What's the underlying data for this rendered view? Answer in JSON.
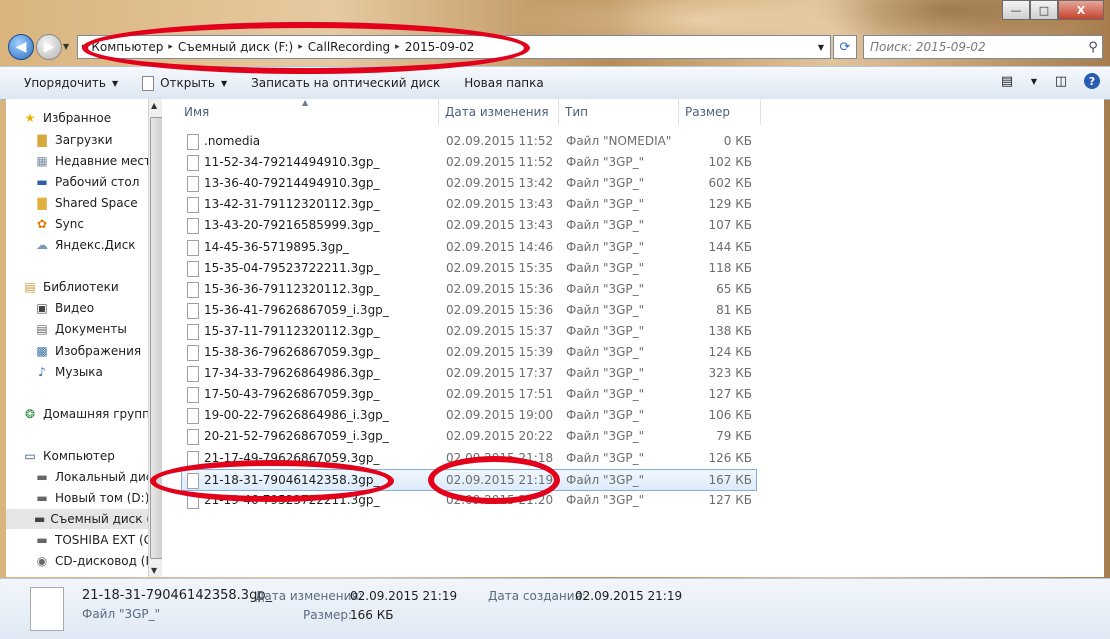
{
  "window": {
    "minimize_glyph": "—",
    "maximize_glyph": "□",
    "close_glyph": "X"
  },
  "address": {
    "crumbs": [
      "Компьютер",
      "Съемный диск (F:)",
      "CallRecording",
      "2015-09-02"
    ],
    "search_placeholder": "Поиск: 2015-09-02"
  },
  "toolbar": {
    "organize": "Упорядочить",
    "open": "Открыть",
    "burn": "Записать на оптический диск",
    "new_folder": "Новая папка"
  },
  "nav": {
    "favorites": "Избранное",
    "downloads": "Загрузки",
    "recent": "Недавние места",
    "desktop": "Рабочий стол",
    "shared": "Shared Space",
    "sync": "Sync",
    "yadisk": "Яндекс.Диск",
    "libraries": "Библиотеки",
    "video": "Видео",
    "documents": "Документы",
    "images": "Изображения",
    "music": "Музыка",
    "homegroup": "Домашняя группа",
    "computer": "Компьютер",
    "local": "Локальный диск",
    "newvol": "Новый том (D:)",
    "removable": "Съемный диск (",
    "toshiba": "TOSHIBA EXT (G:",
    "cdrom": "CD-дисковод (H"
  },
  "columns": {
    "name": "Имя",
    "date": "Дата изменения",
    "type": "Тип",
    "size": "Размер"
  },
  "files": [
    {
      "name": ".nomedia",
      "date": "02.09.2015 11:52",
      "type": "Файл \"NOMEDIA\"",
      "size": "0 КБ"
    },
    {
      "name": "11-52-34-79214494910.3gp_",
      "date": "02.09.2015 11:52",
      "type": "Файл \"3GP_\"",
      "size": "102 КБ"
    },
    {
      "name": "13-36-40-79214494910.3gp_",
      "date": "02.09.2015 13:42",
      "type": "Файл \"3GP_\"",
      "size": "602 КБ"
    },
    {
      "name": "13-42-31-79112320112.3gp_",
      "date": "02.09.2015 13:43",
      "type": "Файл \"3GP_\"",
      "size": "129 КБ"
    },
    {
      "name": "13-43-20-79216585999.3gp_",
      "date": "02.09.2015 13:43",
      "type": "Файл \"3GP_\"",
      "size": "107 КБ"
    },
    {
      "name": "14-45-36-5719895.3gp_",
      "date": "02.09.2015 14:46",
      "type": "Файл \"3GP_\"",
      "size": "144 КБ"
    },
    {
      "name": "15-35-04-79523722211.3gp_",
      "date": "02.09.2015 15:35",
      "type": "Файл \"3GP_\"",
      "size": "118 КБ"
    },
    {
      "name": "15-36-36-79112320112.3gp_",
      "date": "02.09.2015 15:36",
      "type": "Файл \"3GP_\"",
      "size": "65 КБ"
    },
    {
      "name": "15-36-41-79626867059_i.3gp_",
      "date": "02.09.2015 15:36",
      "type": "Файл \"3GP_\"",
      "size": "81 КБ"
    },
    {
      "name": "15-37-11-79112320112.3gp_",
      "date": "02.09.2015 15:37",
      "type": "Файл \"3GP_\"",
      "size": "138 КБ"
    },
    {
      "name": "15-38-36-79626867059.3gp_",
      "date": "02.09.2015 15:39",
      "type": "Файл \"3GP_\"",
      "size": "124 КБ"
    },
    {
      "name": "17-34-33-79626864986.3gp_",
      "date": "02.09.2015 17:37",
      "type": "Файл \"3GP_\"",
      "size": "323 КБ"
    },
    {
      "name": "17-50-43-79626867059.3gp_",
      "date": "02.09.2015 17:51",
      "type": "Файл \"3GP_\"",
      "size": "127 КБ"
    },
    {
      "name": "19-00-22-79626864986_i.3gp_",
      "date": "02.09.2015 19:00",
      "type": "Файл \"3GP_\"",
      "size": "106 КБ"
    },
    {
      "name": "20-21-52-79626867059_i.3gp_",
      "date": "02.09.2015 20:22",
      "type": "Файл \"3GP_\"",
      "size": "79 КБ"
    },
    {
      "name": "21-17-49-79626867059.3gp_",
      "date": "02.09.2015 21:18",
      "type": "Файл \"3GP_\"",
      "size": "126 КБ"
    },
    {
      "name": "21-18-31-79046142358.3gp_",
      "date": "02.09.2015 21:19",
      "type": "Файл \"3GP_\"",
      "size": "167 КБ"
    },
    {
      "name": "21-19-46-79523722211.3gp_",
      "date": "02.09.2015 21:20",
      "type": "Файл \"3GP_\"",
      "size": "127 КБ"
    }
  ],
  "details": {
    "filename": "21-18-31-79046142358.3gp_",
    "filetype": "Файл \"3GP_\"",
    "modified_label": "Дата изменения:",
    "modified_value": "02.09.2015 21:19",
    "created_label": "Дата создания:",
    "created_value": "02.09.2015 21:19",
    "size_label": "Размер:",
    "size_value": "166 КБ"
  }
}
